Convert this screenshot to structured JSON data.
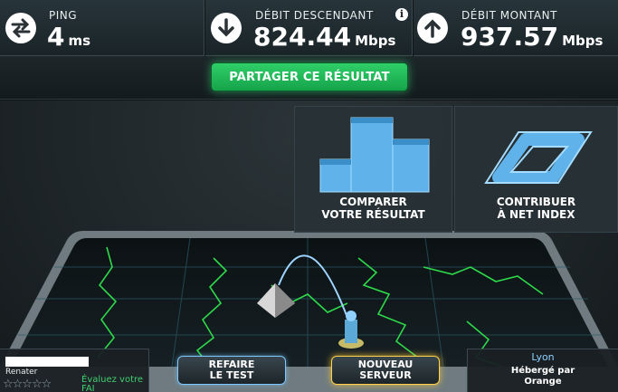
{
  "ping": {
    "label": "PING",
    "value": "4",
    "unit": "ms"
  },
  "download": {
    "label": "DÉBIT DESCENDANT",
    "value": "824.44",
    "unit": "Mbps"
  },
  "upload": {
    "label": "DÉBIT MONTANT",
    "value": "937.57",
    "unit": "Mbps"
  },
  "share_label": "PARTAGER CE RÉSULTAT",
  "compare": {
    "line1": "COMPARER",
    "line2": "VOTRE RÉSULTAT"
  },
  "contribute": {
    "line1": "CONTRIBUER",
    "line2": "À NET INDEX"
  },
  "isp": {
    "name": "Renater",
    "rate_line1": "Évaluez votre",
    "rate_line2": "FAI"
  },
  "redo": {
    "line1": "REFAIRE",
    "line2": "LE TEST"
  },
  "new_server": {
    "line1": "NOUVEAU",
    "line2": "SERVEUR"
  },
  "server": {
    "city": "Lyon",
    "hosted_line1": "Hébergé par",
    "hosted_line2": "Orange"
  },
  "colors": {
    "accent_green": "#2fcf69",
    "accent_gold": "#ffd24a",
    "accent_blue": "#8fd0ff"
  }
}
